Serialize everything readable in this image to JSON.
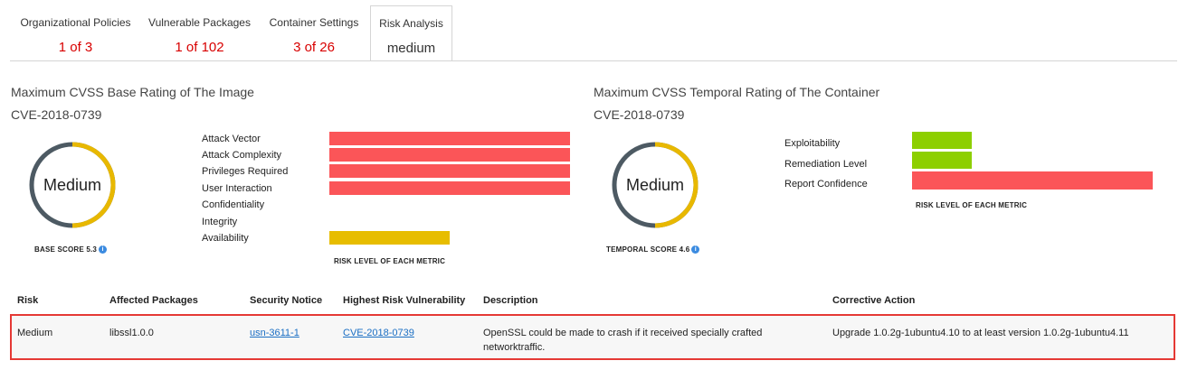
{
  "tabs": [
    {
      "label": "Organizational Policies",
      "value": "1 of 3"
    },
    {
      "label": "Vulnerable Packages",
      "value": "1 of 102"
    },
    {
      "label": "Container Settings",
      "value": "3 of 26"
    },
    {
      "label": "Risk Analysis",
      "value": "medium",
      "active": true
    }
  ],
  "base": {
    "title": "Maximum CVSS Base Rating of The Image",
    "cve": "CVE-2018-0739",
    "gauge_label": "Medium",
    "score_label": "BASE SCORE 5.3",
    "metrics": [
      {
        "label": "Attack Vector",
        "level": "high",
        "color": "#fb5558"
      },
      {
        "label": "Attack Complexity",
        "level": "high",
        "color": "#fb5558"
      },
      {
        "label": "Privileges Required",
        "level": "high",
        "color": "#fb5558"
      },
      {
        "label": "User Interaction",
        "level": "high",
        "color": "#fb5558"
      },
      {
        "label": "Confidentiality",
        "level": "none"
      },
      {
        "label": "Integrity",
        "level": "none"
      },
      {
        "label": "Availability",
        "level": "low",
        "color": "#e7bd00"
      }
    ],
    "caption": "RISK LEVEL OF EACH METRIC"
  },
  "temporal": {
    "title": "Maximum CVSS Temporal Rating of The Container",
    "cve": "CVE-2018-0739",
    "gauge_label": "Medium",
    "score_label": "TEMPORAL SCORE 4.6",
    "metrics": [
      {
        "label": "Exploitability",
        "level": "low",
        "color": "#8dcf00"
      },
      {
        "label": "Remediation Level",
        "level": "low",
        "color": "#8dcf00"
      },
      {
        "label": "Report Confidence",
        "level": "high",
        "color": "#fb5558"
      }
    ],
    "caption": "RISK LEVEL OF EACH METRIC"
  },
  "table": {
    "headers": [
      "Risk",
      "Affected Packages",
      "Security Notice",
      "Highest Risk Vulnerability",
      "Description",
      "Corrective Action"
    ],
    "row": {
      "risk": "Medium",
      "package": "libssl1.0.0",
      "notice": "usn-3611-1",
      "vulnerability": "CVE-2018-0739",
      "description": "OpenSSL could be made to crash if it received specially crafted networktraffic.",
      "action": "Upgrade 1.0.2g-1ubuntu4.10 to at least version 1.0.2g-1ubuntu4.11"
    }
  },
  "colors": {
    "high": "#fb5558",
    "medium": "#e7bd00",
    "low": "#8dcf00",
    "tab_value": "#d80000",
    "gauge_dark": "#4d5a63",
    "gauge_yellow": "#e8b800",
    "highlight": "#e53935"
  },
  "icons": {
    "info": "info-icon"
  }
}
